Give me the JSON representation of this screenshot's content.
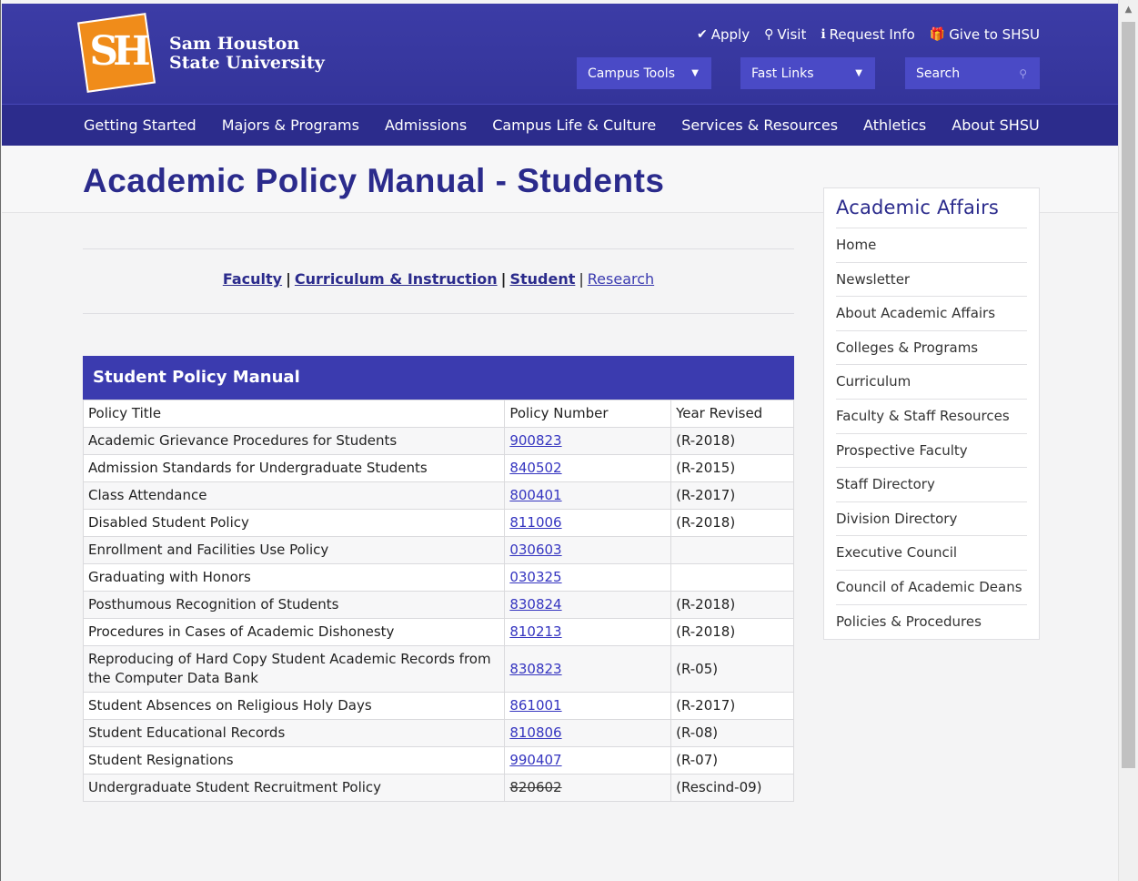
{
  "brand": {
    "logo_letters": "SH",
    "name_line1": "Sam Houston",
    "name_line2": "State University"
  },
  "util_links": [
    {
      "icon": "check-icon",
      "glyph": "✔",
      "label": "Apply"
    },
    {
      "icon": "map-pin-icon",
      "glyph": "⚲",
      "label": "Visit"
    },
    {
      "icon": "info-icon",
      "glyph": "ℹ",
      "label": "Request Info"
    },
    {
      "icon": "gift-icon",
      "glyph": "🎁",
      "label": "Give to SHSU"
    }
  ],
  "toolbar": {
    "campus_tools": "Campus Tools",
    "fast_links": "Fast Links",
    "search_placeholder": "Search"
  },
  "nav": [
    "Getting Started",
    "Majors & Programs",
    "Admissions",
    "Campus Life & Culture",
    "Services & Resources",
    "Athletics",
    "About SHSU"
  ],
  "page_title": "Academic Policy Manual - Students",
  "sublinks": {
    "faculty": "Faculty",
    "curriculum": "Curriculum & Instruction",
    "student": "Student",
    "research": "Research",
    "sep": "|"
  },
  "table": {
    "caption": "Student Policy Manual",
    "headers": [
      "Policy Title",
      "Policy Number",
      "Year Revised"
    ],
    "rows": [
      {
        "title": "Academic Grievance Procedures for Students",
        "number": "900823",
        "year": "(R-2018)"
      },
      {
        "title": "Admission Standards for Undergraduate Students",
        "number": "840502",
        "year": "(R-2015)"
      },
      {
        "title": "Class Attendance",
        "number": "800401",
        "year": "(R-2017)"
      },
      {
        "title": "Disabled Student Policy",
        "number": "811006",
        "year": "(R-2018)"
      },
      {
        "title": "Enrollment and Facilities Use Policy",
        "number": "030603",
        "year": ""
      },
      {
        "title": "Graduating with Honors",
        "number": "030325",
        "year": ""
      },
      {
        "title": "Posthumous Recognition of Students",
        "number": "830824",
        "year": "(R-2018)"
      },
      {
        "title": "Procedures in Cases of Academic Dishonesty",
        "number": "810213",
        "year": "(R-2018)"
      },
      {
        "title": "Reproducing of Hard Copy Student Academic Records from the Computer Data Bank",
        "number": "830823",
        "year": "(R-05)"
      },
      {
        "title": "Student Absences on Religious Holy Days",
        "number": "861001",
        "year": "(R-2017)"
      },
      {
        "title": "Student Educational Records",
        "number": "810806",
        "year": "(R-08)"
      },
      {
        "title": "Student Resignations",
        "number": "990407",
        "year": "(R-07)"
      },
      {
        "title": "Undergraduate Student Recruitment Policy",
        "number": "820602",
        "year": "(Rescind-09)"
      }
    ]
  },
  "sidebar": {
    "title": "Academic Affairs",
    "items": [
      "Home",
      "Newsletter",
      "About Academic Affairs",
      "Colleges & Programs",
      "Curriculum",
      "Faculty & Staff Resources",
      "Prospective Faculty",
      "Staff Directory",
      "Division Directory",
      "Executive Council",
      "Council of Academic Deans",
      "Policies & Procedures"
    ]
  },
  "colors": {
    "header_blue": "#3a3aa0",
    "nav_blue": "#2c2c8c",
    "title_blue": "#2b2b8c",
    "logo_orange": "#f08c1a"
  }
}
